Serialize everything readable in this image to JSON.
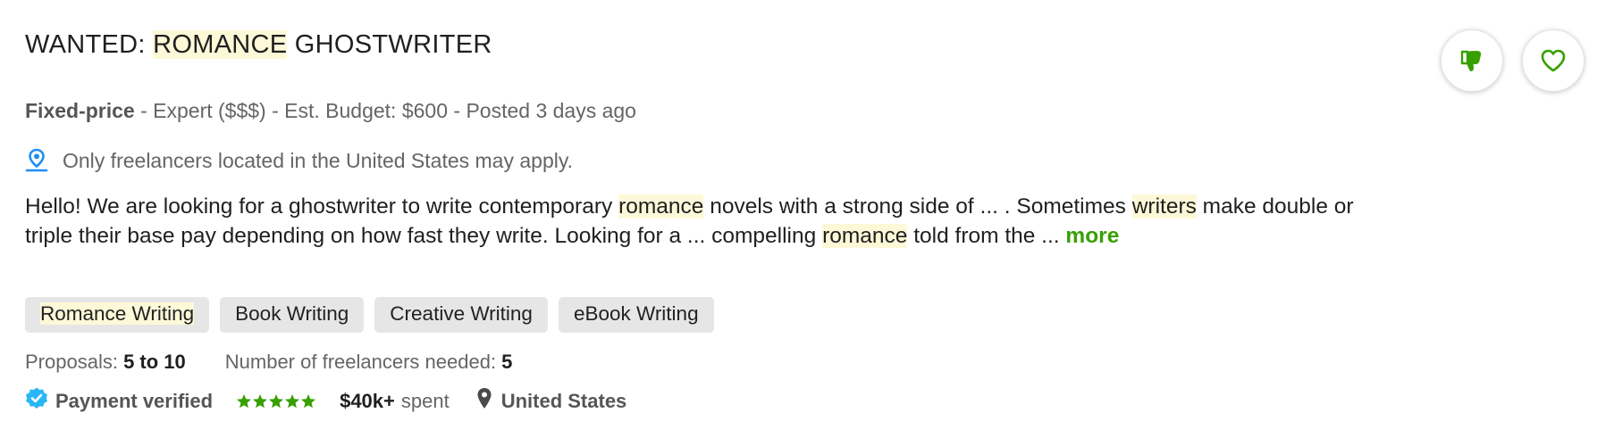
{
  "job": {
    "title_prefix": "WANTED: ",
    "title_highlight": "ROMANCE",
    "title_suffix": " GHOSTWRITER",
    "meta": {
      "type": "Fixed-price",
      "details": " - Expert ($$$) - Est. Budget: $600 - Posted 3 days ago"
    },
    "location_requirement": "Only freelancers located in the United States may apply.",
    "description": {
      "p1": "Hello! We are looking for a ghostwriter to write contemporary ",
      "h1": "romance",
      "p2": " novels with a strong side of ... . Sometimes ",
      "h2": "writers",
      "p3": " make double or triple their base pay depending on how fast they write. Looking for a ... compelling ",
      "h3": "romance",
      "p4": " told from the ... ",
      "more_link": "more"
    },
    "skills": [
      "Romance Writing",
      "Book Writing",
      "Creative Writing",
      "eBook Writing"
    ],
    "proposals": {
      "label": "Proposals: ",
      "value": "5 to 10"
    },
    "freelancers_needed": {
      "label": "Number of freelancers needed: ",
      "value": "5"
    },
    "client": {
      "payment_status": "Payment verified",
      "rating": 5,
      "spent_amount": "$40k+",
      "spent_label": "spent",
      "country": "United States"
    }
  },
  "actions": {
    "dislike_icon": "thumbs-down-icon",
    "save_icon": "heart-icon"
  },
  "colors": {
    "accent_green": "#37a000",
    "highlight": "#fdf8d8",
    "verified_blue": "#29b6f6",
    "pin_blue": "#1d8ff2"
  }
}
